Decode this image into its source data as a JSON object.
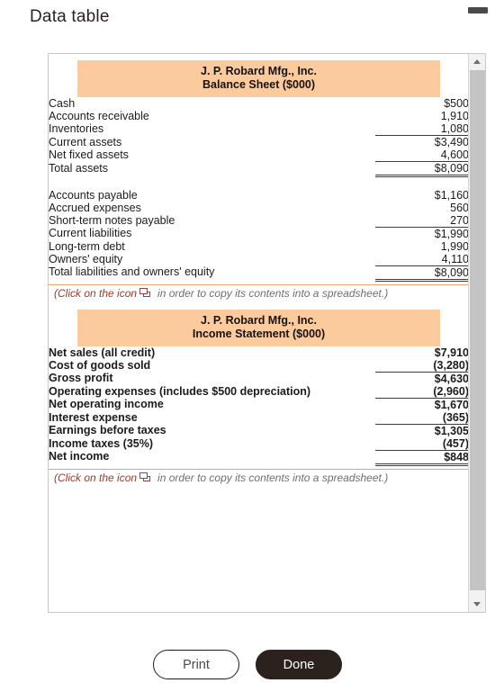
{
  "window": {
    "title": "Data table",
    "minimize_icon": "minimize-icon"
  },
  "balance_sheet": {
    "company": "J. P. Robard Mfg., Inc.",
    "statement": "Balance Sheet ($000)",
    "rows": [
      {
        "label": "Cash",
        "value": "$500",
        "indent": 0,
        "rule": "none",
        "bold": false
      },
      {
        "label": "Accounts receivable",
        "value": "1,910",
        "indent": 0,
        "rule": "none",
        "bold": false
      },
      {
        "label": "Inventories",
        "value": "1,080",
        "indent": 0,
        "rule": "none",
        "bold": false
      },
      {
        "label": "Current assets",
        "value": "$3,490",
        "indent": 1,
        "rule": "single",
        "bold": false
      },
      {
        "label": "Net fixed assets",
        "value": "4,600",
        "indent": 0,
        "rule": "none",
        "bold": false
      },
      {
        "label": "Total assets",
        "value": "$8,090",
        "indent": 1,
        "rule": "both",
        "bold": false
      },
      {
        "label": "",
        "value": "",
        "indent": 0,
        "rule": "spacer",
        "bold": false
      },
      {
        "label": "Accounts payable",
        "value": "$1,160",
        "indent": 0,
        "rule": "none",
        "bold": false
      },
      {
        "label": "Accrued expenses",
        "value": "560",
        "indent": 0,
        "rule": "none",
        "bold": false
      },
      {
        "label": "Short-term notes payable",
        "value": "270",
        "indent": 0,
        "rule": "none",
        "bold": false
      },
      {
        "label": "Current liabilities",
        "value": "$1,990",
        "indent": 1,
        "rule": "single",
        "bold": false
      },
      {
        "label": "Long-term debt",
        "value": "1,990",
        "indent": 0,
        "rule": "none",
        "bold": false
      },
      {
        "label": "Owners' equity",
        "value": "4,110",
        "indent": 0,
        "rule": "none",
        "bold": false
      },
      {
        "label": "Total liabilities and owners' equity",
        "value": "$8,090",
        "indent": 1,
        "rule": "both",
        "bold": false
      }
    ],
    "caption_prefix": "(Click on the icon",
    "caption_suffix": "in order to copy its contents into a spreadsheet.)",
    "caption_icon": "copy-to-spreadsheet-icon"
  },
  "income_statement": {
    "company": "J. P. Robard Mfg., Inc.",
    "statement": "Income Statement ($000)",
    "rows": [
      {
        "label": "Net sales (all credit)",
        "value": "$7,910",
        "indent": 0,
        "rule": "none",
        "bold": true
      },
      {
        "label": "Cost of goods sold",
        "value": "(3,280)",
        "indent": 0,
        "rule": "none",
        "bold": true
      },
      {
        "label": "Gross profit",
        "value": "$4,630",
        "indent": 1,
        "rule": "single",
        "bold": true
      },
      {
        "label": "Operating expenses (includes $500 depreciation)",
        "value": "(2,960)",
        "indent": 0,
        "rule": "none",
        "bold": true
      },
      {
        "label": "Net operating income",
        "value": "$1,670",
        "indent": 2,
        "rule": "single",
        "bold": true
      },
      {
        "label": "Interest expense",
        "value": "(365)",
        "indent": 0,
        "rule": "none",
        "bold": true
      },
      {
        "label": "Earnings before taxes",
        "value": "$1,305",
        "indent": 2,
        "rule": "single",
        "bold": true
      },
      {
        "label": "Income taxes (35%)",
        "value": "(457)",
        "indent": 0,
        "rule": "none",
        "bold": true
      },
      {
        "label": "Net income",
        "value": "$848",
        "indent": 0,
        "rule": "both",
        "bold": true
      }
    ],
    "caption_prefix": "(Click on the icon",
    "caption_suffix": "in order to copy its contents into a spreadsheet.)",
    "caption_icon": "copy-to-spreadsheet-icon"
  },
  "scrollbar": {
    "up_icon": "scroll-up-arrow-icon",
    "down_icon": "scroll-down-arrow-icon",
    "thumb": "scrollbar-thumb"
  },
  "footer": {
    "print_label": "Print",
    "done_label": "Done"
  },
  "colors": {
    "header_orange": "#fbcb9e",
    "done_button": "#2b211d",
    "caption_gray": "#6f6f6f",
    "caption_accent": "#9b3b2a"
  }
}
